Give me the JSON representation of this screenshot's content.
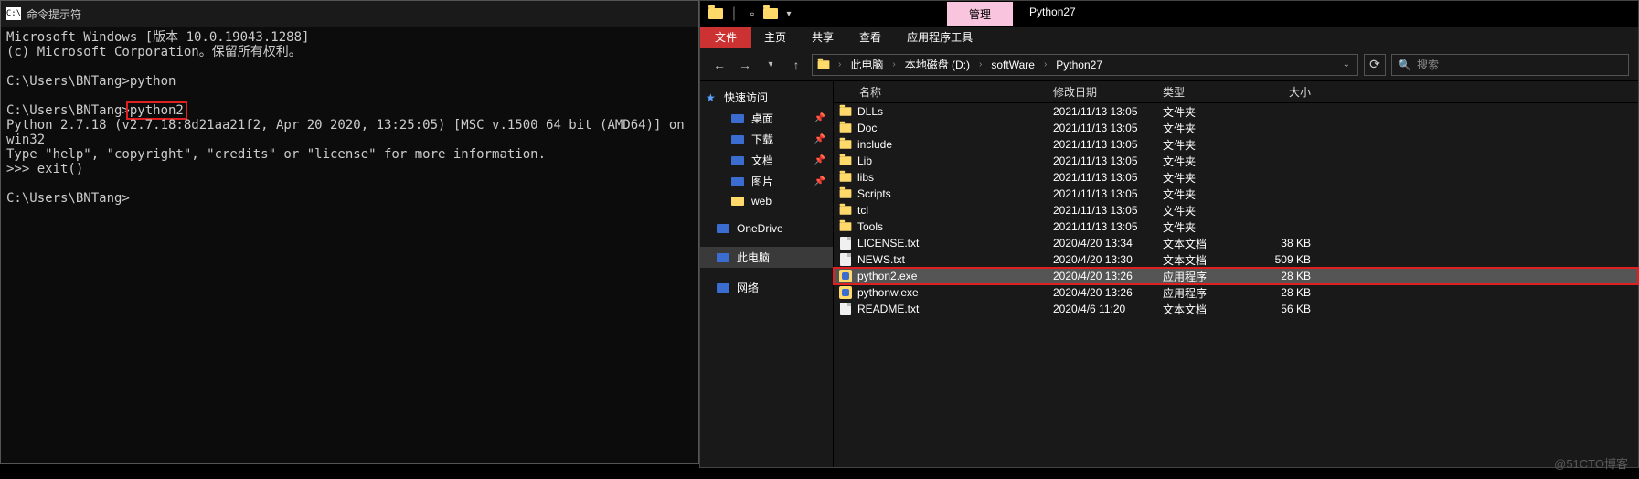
{
  "cmd": {
    "title": "命令提示符",
    "lines": {
      "l1": "Microsoft Windows [版本 10.0.19043.1288]",
      "l2": "(c) Microsoft Corporation。保留所有权利。",
      "l3": "",
      "l4": "C:\\Users\\BNTang>python",
      "l5": "",
      "l6a": "C:\\Users\\BNTang>",
      "l6b": "python2",
      "l7": "Python 2.7.18 (v2.7.18:8d21aa21f2, Apr 20 2020, 13:25:05) [MSC v.1500 64 bit (AMD64)] on win32",
      "l8": "Type \"help\", \"copyright\", \"credits\" or \"license\" for more information.",
      "l9": ">>> exit()",
      "l10": "",
      "l11": "C:\\Users\\BNTang>"
    }
  },
  "explorer": {
    "manage_tab": "管理",
    "folder_title": "Python27",
    "ribbon": {
      "file": "文件",
      "home": "主页",
      "share": "共享",
      "view": "查看",
      "app_tools": "应用程序工具"
    },
    "breadcrumb": [
      "此电脑",
      "本地磁盘 (D:)",
      "softWare",
      "Python27"
    ],
    "search_placeholder": "搜索",
    "sidebar": {
      "quick": "快速访问",
      "desktop": "桌面",
      "downloads": "下载",
      "documents": "文档",
      "pictures": "图片",
      "web": "web",
      "onedrive": "OneDrive",
      "this_pc": "此电脑",
      "network": "网络"
    },
    "columns": {
      "name": "名称",
      "date": "修改日期",
      "type": "类型",
      "size": "大小"
    },
    "rows": [
      {
        "icon": "folder",
        "name": "DLLs",
        "date": "2021/11/13 13:05",
        "type": "文件夹",
        "size": ""
      },
      {
        "icon": "folder",
        "name": "Doc",
        "date": "2021/11/13 13:05",
        "type": "文件夹",
        "size": ""
      },
      {
        "icon": "folder",
        "name": "include",
        "date": "2021/11/13 13:05",
        "type": "文件夹",
        "size": ""
      },
      {
        "icon": "folder",
        "name": "Lib",
        "date": "2021/11/13 13:05",
        "type": "文件夹",
        "size": ""
      },
      {
        "icon": "folder",
        "name": "libs",
        "date": "2021/11/13 13:05",
        "type": "文件夹",
        "size": ""
      },
      {
        "icon": "folder",
        "name": "Scripts",
        "date": "2021/11/13 13:05",
        "type": "文件夹",
        "size": ""
      },
      {
        "icon": "folder",
        "name": "tcl",
        "date": "2021/11/13 13:05",
        "type": "文件夹",
        "size": ""
      },
      {
        "icon": "folder",
        "name": "Tools",
        "date": "2021/11/13 13:05",
        "type": "文件夹",
        "size": ""
      },
      {
        "icon": "doc",
        "name": "LICENSE.txt",
        "date": "2020/4/20 13:34",
        "type": "文本文档",
        "size": "38 KB"
      },
      {
        "icon": "doc",
        "name": "NEWS.txt",
        "date": "2020/4/20 13:30",
        "type": "文本文档",
        "size": "509 KB"
      },
      {
        "icon": "py",
        "name": "python2.exe",
        "date": "2020/4/20 13:26",
        "type": "应用程序",
        "size": "28 KB",
        "selected": true,
        "redbox": true
      },
      {
        "icon": "py",
        "name": "pythonw.exe",
        "date": "2020/4/20 13:26",
        "type": "应用程序",
        "size": "28 KB"
      },
      {
        "icon": "doc",
        "name": "README.txt",
        "date": "2020/4/6 11:20",
        "type": "文本文档",
        "size": "56 KB"
      }
    ]
  },
  "watermark": "@51CTO博客"
}
